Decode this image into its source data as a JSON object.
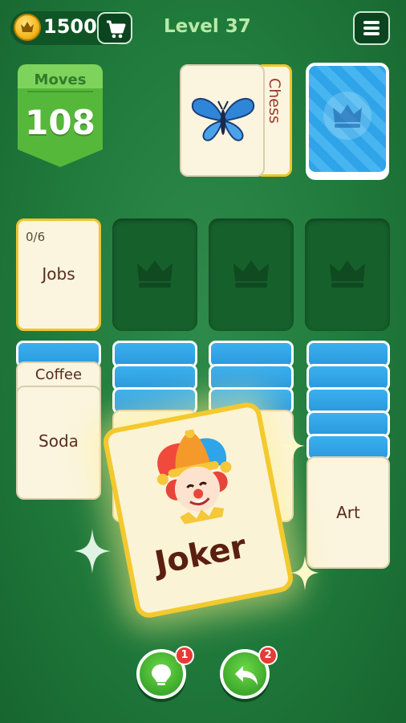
{
  "header": {
    "coins": "1500",
    "level": "Level 37",
    "icons": [
      "crown-coin-icon",
      "cart-icon",
      "menu-icon"
    ]
  },
  "moves": {
    "label": "Moves",
    "value": "108"
  },
  "stock": {
    "top_card_image": "butterfly",
    "side_card_label": "Chess",
    "deck_icon": "crown-icon"
  },
  "foundations": [
    {
      "label": "Jobs",
      "progress": "0/6",
      "filled": true
    },
    {
      "icon": "crown-icon",
      "filled": false
    },
    {
      "icon": "crown-icon",
      "filled": false
    },
    {
      "icon": "crown-icon",
      "filled": false
    }
  ],
  "tableau": [
    {
      "hidden_count": 1,
      "cards": [
        "Coffee",
        "Soda"
      ]
    },
    {
      "hidden_count": 4,
      "cards": []
    },
    {
      "hidden_count": 4,
      "cards": []
    },
    {
      "hidden_count": 5,
      "cards": [
        "Art"
      ]
    }
  ],
  "dragged_card": {
    "label": "Joker",
    "image": "jester-clown"
  },
  "buttons": {
    "hint": {
      "icon": "lightbulb-icon",
      "badge": "1"
    },
    "undo": {
      "icon": "undo-icon",
      "badge": "2"
    }
  },
  "colors": {
    "table": "#207a3c",
    "card_face": "#fbf5df",
    "card_back": "#2fa4e8",
    "highlight": "#f0c52b",
    "badge": "#e53a35"
  }
}
